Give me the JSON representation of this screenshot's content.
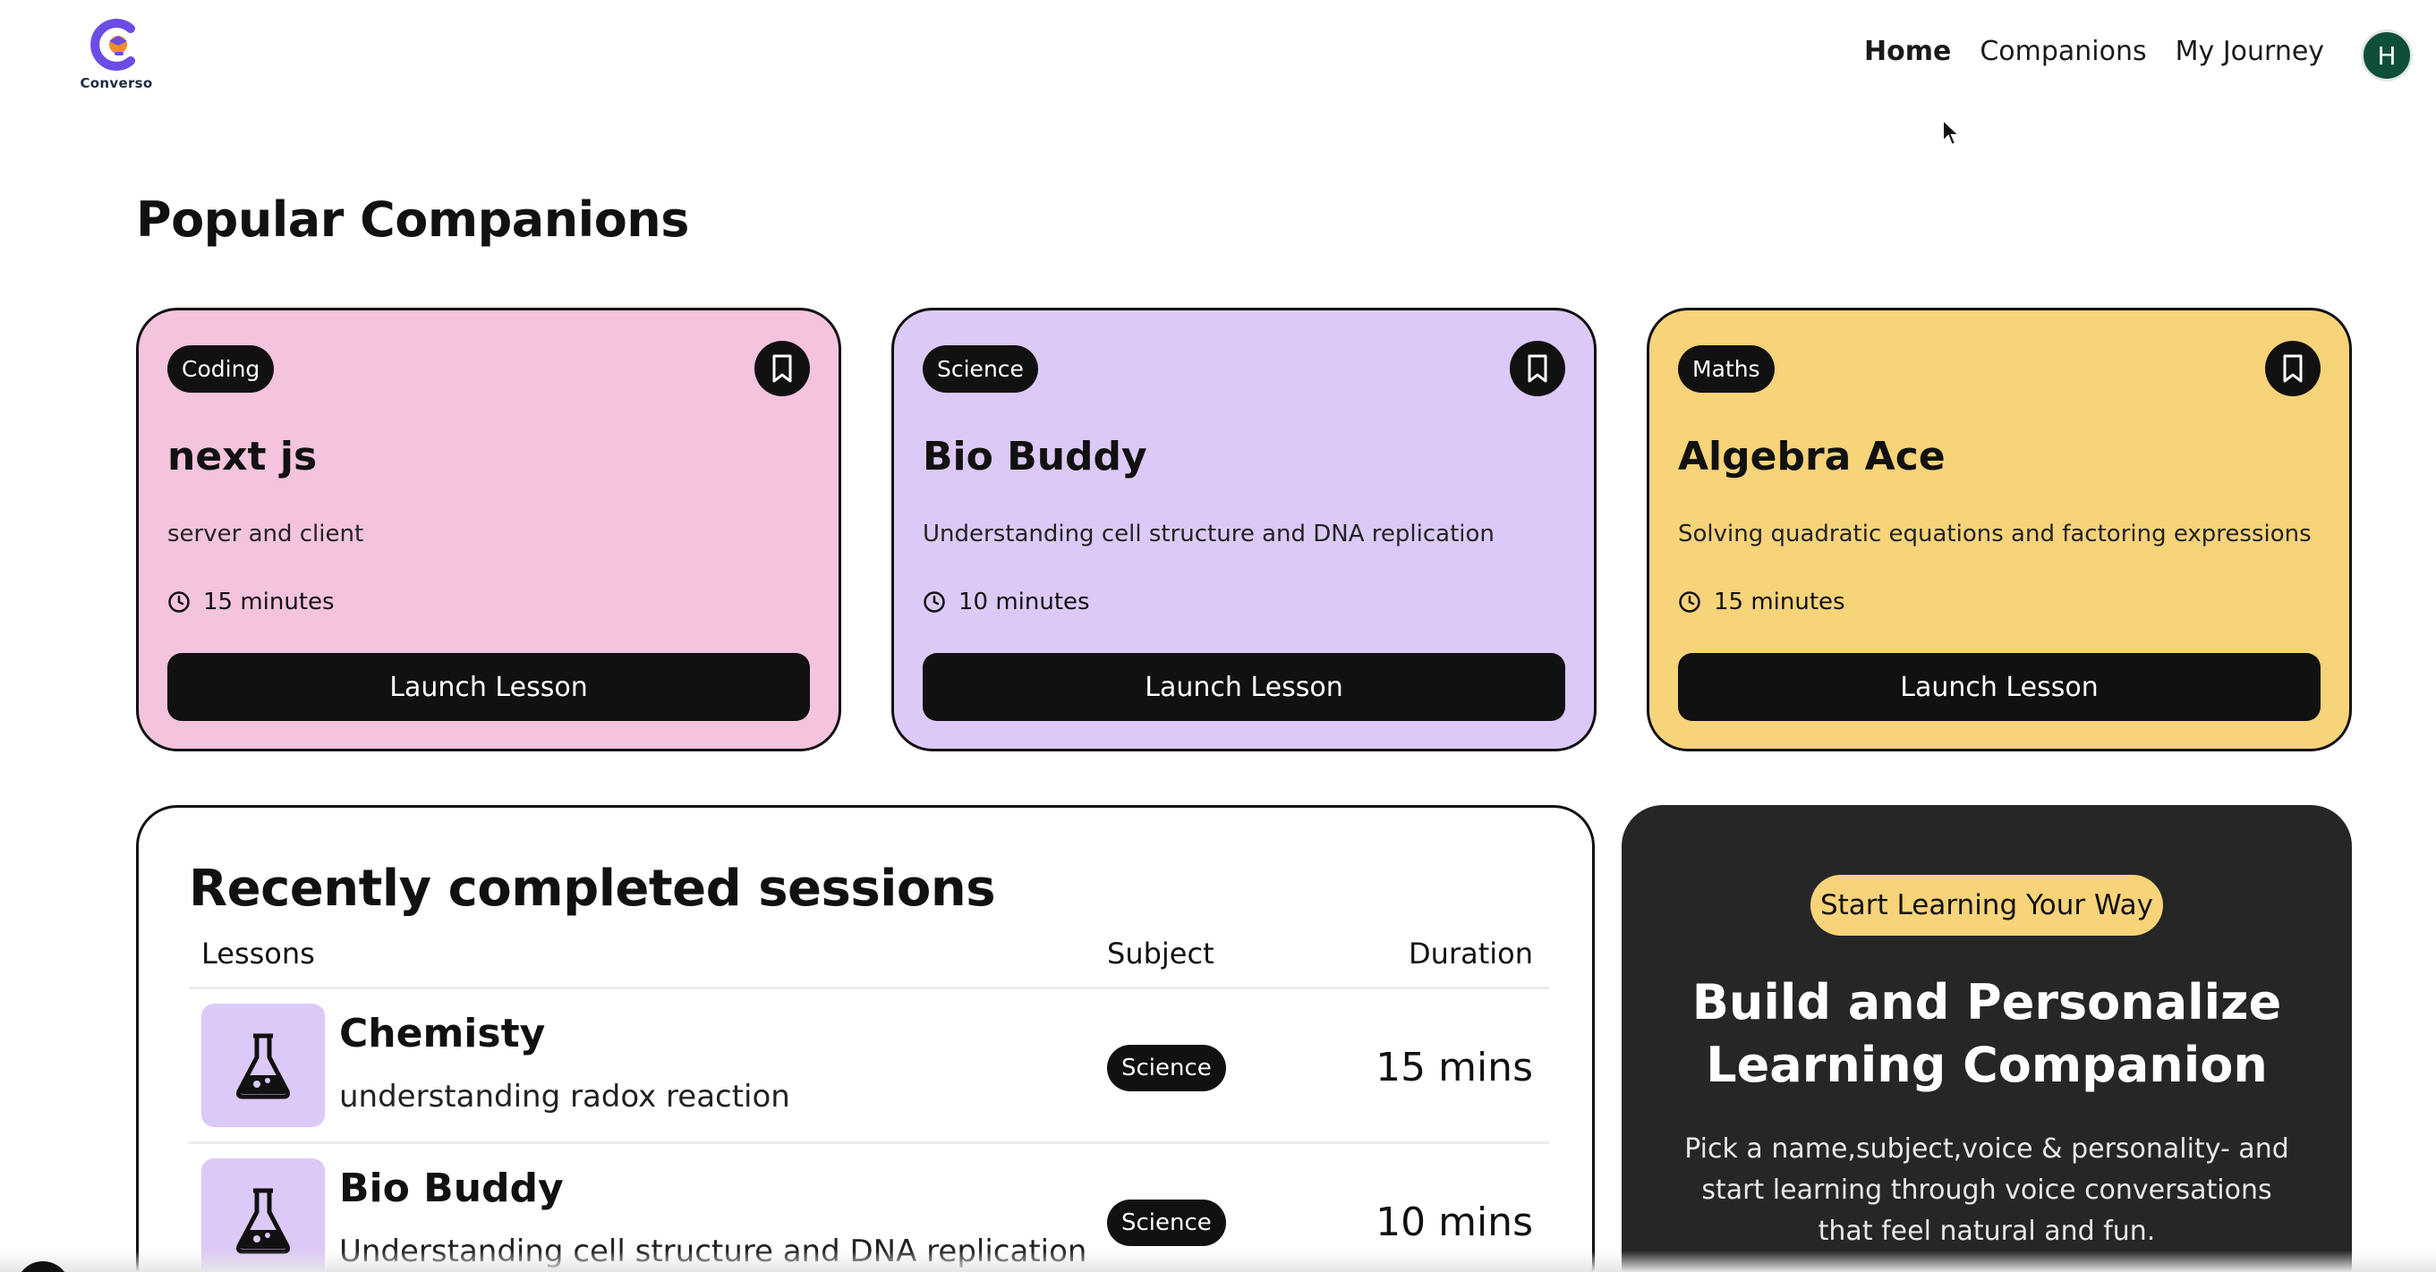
{
  "brand": {
    "name": "Converso",
    "colors": {
      "accent_purple": "#6b4ce6",
      "accent_orange": "#f28c28"
    }
  },
  "nav": {
    "links": [
      {
        "label": "Home",
        "active": true
      },
      {
        "label": "Companions",
        "active": false
      },
      {
        "label": "My Journey",
        "active": false
      }
    ],
    "avatar_initial": "H",
    "avatar_color": "#0f4f3a"
  },
  "popular": {
    "title": "Popular Companions",
    "cards": [
      {
        "subject": "Coding",
        "name": "next js",
        "topic": "server and client",
        "duration": "15 minutes",
        "button": "Launch Lesson",
        "color": "#f4c3dd",
        "icon": "bookmark-icon"
      },
      {
        "subject": "Science",
        "name": "Bio Buddy",
        "topic": "Understanding cell structure and DNA replication",
        "duration": "10 minutes",
        "button": "Launch Lesson",
        "color": "#dcc9f7",
        "icon": "bookmark-icon"
      },
      {
        "subject": "Maths",
        "name": "Algebra Ace",
        "topic": "Solving quadratic equations and factoring expressions",
        "duration": "15 minutes",
        "button": "Launch Lesson",
        "color": "#f7d379",
        "icon": "bookmark-icon"
      }
    ]
  },
  "sessions": {
    "title": "Recently completed sessions",
    "columns": {
      "lessons": "Lessons",
      "subject": "Subject",
      "duration": "Duration"
    },
    "rows": [
      {
        "name": "Chemisty",
        "topic": "understanding radox reaction",
        "subject": "Science",
        "duration": "15 mins",
        "icon": "flask-icon"
      },
      {
        "name": "Bio Buddy",
        "topic": "Understanding cell structure and DNA replication",
        "subject": "Science",
        "duration": "10 mins",
        "icon": "flask-icon"
      }
    ]
  },
  "cta": {
    "badge": "Start Learning Your Way",
    "heading": "Build and Personalize Learning Companion",
    "text": "Pick a name,subject,voice & personality- and start learning through voice conversations that feel natural and fun."
  }
}
